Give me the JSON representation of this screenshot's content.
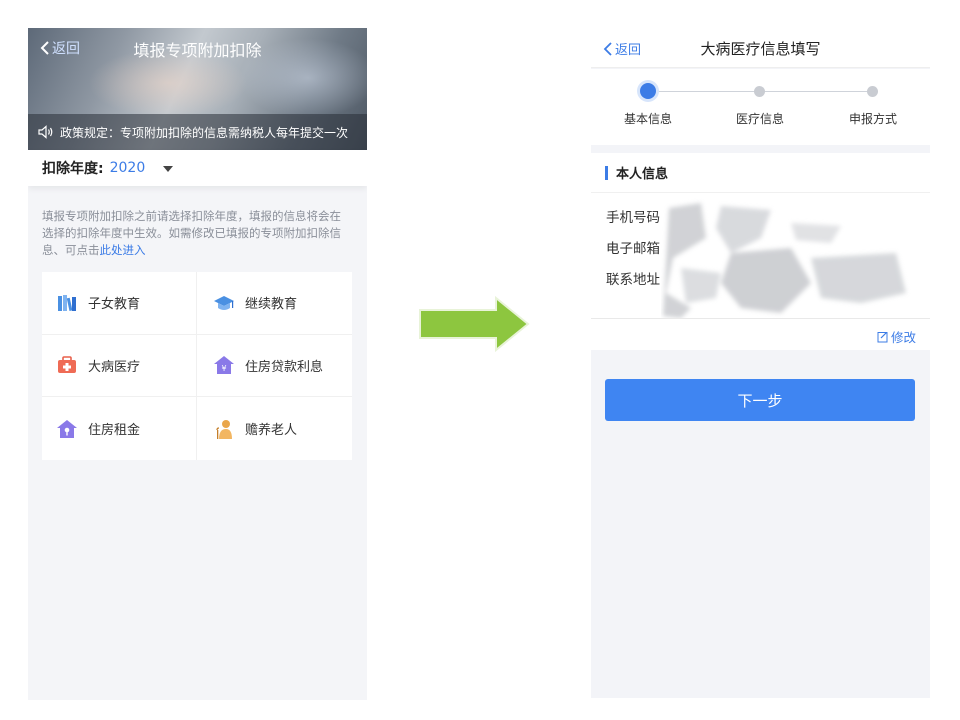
{
  "left": {
    "back_label": "返回",
    "title": "填报专项附加扣除",
    "notice": "政策规定：专项附加扣除的信息需纳税人每年提交一次",
    "year_label": "扣除年度:",
    "year_value": "2020",
    "description": "填报专项附加扣除之前请选择扣除年度，填报的信息将会在选择的扣除年度中生效。如需修改已填报的专项附加扣除信息、可点击",
    "description_link": "此处进入",
    "items": [
      {
        "label": "子女教育",
        "icon": "books-icon"
      },
      {
        "label": "继续教育",
        "icon": "graduation-cap-icon"
      },
      {
        "label": "大病医疗",
        "icon": "medical-kit-icon"
      },
      {
        "label": "住房贷款利息",
        "icon": "house-yen-icon"
      },
      {
        "label": "住房租金",
        "icon": "house-key-icon"
      },
      {
        "label": "赡养老人",
        "icon": "elder-icon"
      }
    ]
  },
  "right": {
    "back_label": "返回",
    "title": "大病医疗信息填写",
    "steps": [
      "基本信息",
      "医疗信息",
      "申报方式"
    ],
    "active_step": 0,
    "section_title": "本人信息",
    "fields": [
      "手机号码",
      "电子邮箱",
      "联系地址"
    ],
    "edit_label": "修改",
    "next_button": "下一步"
  },
  "colors": {
    "accent": "#3c7ce6",
    "button": "#3f85f2",
    "arrow": "#8dc63f"
  }
}
